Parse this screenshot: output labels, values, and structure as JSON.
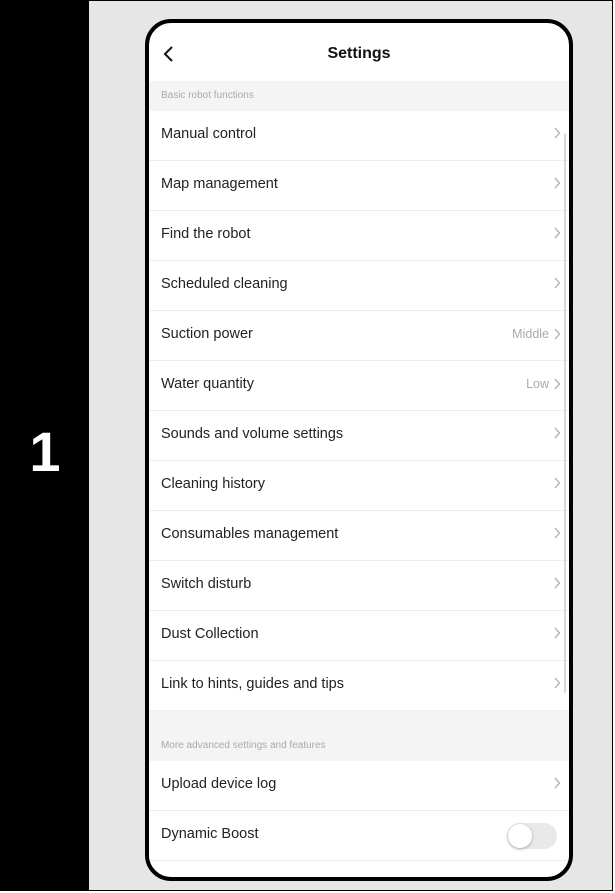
{
  "step_number": "1",
  "header": {
    "title": "Settings",
    "back_icon": "chevron-left-icon"
  },
  "sections": [
    {
      "title": "Basic robot functions",
      "items": [
        {
          "label": "Manual control",
          "value": ""
        },
        {
          "label": "Map management",
          "value": ""
        },
        {
          "label": "Find the robot",
          "value": ""
        },
        {
          "label": "Scheduled cleaning",
          "value": ""
        },
        {
          "label": "Suction power",
          "value": "Middle"
        },
        {
          "label": "Water quantity",
          "value": "Low"
        },
        {
          "label": "Sounds and volume settings",
          "value": ""
        },
        {
          "label": "Cleaning history",
          "value": ""
        },
        {
          "label": "Consumables management",
          "value": ""
        },
        {
          "label": "Switch disturb",
          "value": ""
        },
        {
          "label": "Dust Collection",
          "value": ""
        },
        {
          "label": "Link to hints, guides and tips",
          "value": ""
        }
      ]
    },
    {
      "title": "More advanced settings and features",
      "items": [
        {
          "label": "Upload device log",
          "value": ""
        },
        {
          "label": "Dynamic Boost",
          "toggle": "off"
        }
      ]
    }
  ],
  "colors": {
    "panel_bg": "#e6e6e6",
    "section_bg": "#f4f4f4",
    "secondary_text": "#aaaaaa"
  }
}
